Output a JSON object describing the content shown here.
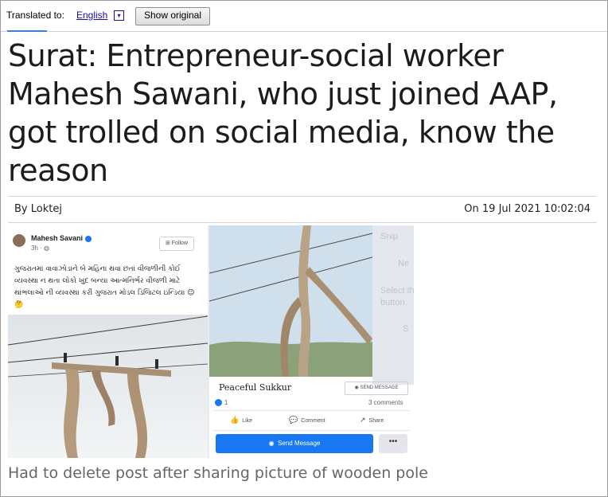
{
  "translate_bar": {
    "label": "Translated to:",
    "language": "English",
    "caret": "▾",
    "show_original": "Show original"
  },
  "article": {
    "title": "Surat: Entrepreneur-social worker Mahesh Sawani, who just joined AAP, got trolled on social media, know the reason",
    "byline": "By Loktej",
    "date": "On 19 Jul 2021 10:02:04",
    "caption": "Had to delete post after sharing picture of wooden pole"
  },
  "image": {
    "left_post": {
      "name": "Mahesh Savani",
      "time": "3h · ",
      "follow": "Follow",
      "text": "ગુજરાતમાં વાવાઝોડાને બે મહિના થવા છતાં વીજળીની કોઈ વ્યવસ્થા ન થતા લોકો ખુદ બન્યા આત્મનિર્ભર વીજળી માટે થાંભલાઓ ની વ્યવસ્થા કરી ગુજરાત મોડલ ડિજિટલ ઇન્ડિયા 😉🤔"
    },
    "right_post": {
      "page_name": "Peaceful Sukkur",
      "send_message_small": "SEND MESSAGE",
      "likes": "1",
      "comments": "3 comments",
      "like": "Like",
      "comment": "Comment",
      "share": "Share",
      "send_message": "Send Message",
      "more": "•••",
      "ghost_lines": [
        "Snip",
        "Ne",
        "Select th",
        "button.",
        "S"
      ]
    }
  }
}
